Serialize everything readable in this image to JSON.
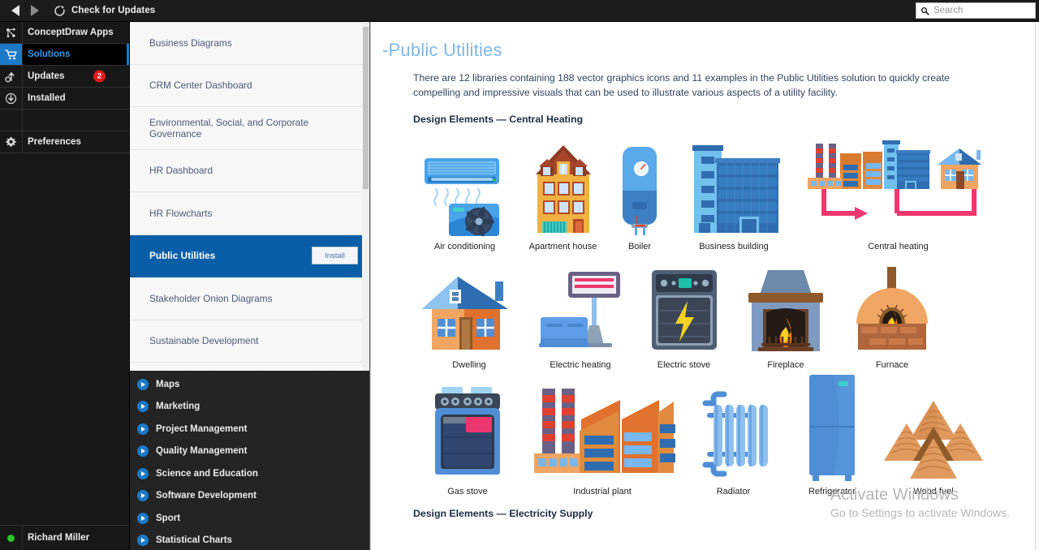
{
  "topbar": {
    "back_icon": "triangle-left-icon",
    "forward_icon": "triangle-right-icon",
    "refresh_icon": "refresh-icon",
    "check_updates_label": "Check for Updates",
    "search_icon": "search-icon",
    "search_placeholder": "Search",
    "search_value": ""
  },
  "sidebar": {
    "items": [
      {
        "label": "ConceptDraw Apps",
        "icon": "apps-network-icon",
        "selected": false,
        "badge": ""
      },
      {
        "label": "Solutions",
        "icon": "shopping-cart-icon",
        "selected": true,
        "badge": ""
      },
      {
        "label": "Updates",
        "icon": "update-arrow-icon",
        "selected": false,
        "badge": "2"
      },
      {
        "label": "Installed",
        "icon": "download-circle-icon",
        "selected": false,
        "badge": ""
      },
      {
        "label": "",
        "icon": "",
        "selected": false,
        "badge": ""
      },
      {
        "label": "Preferences",
        "icon": "gear-icon",
        "selected": false,
        "badge": ""
      }
    ],
    "user": {
      "name": "Richard Miller",
      "status_icon": "online-status-dot",
      "status_color": "#2fc42f"
    }
  },
  "solutions": {
    "items": [
      {
        "name": "Business Diagrams",
        "selected": false,
        "action": ""
      },
      {
        "name": "CRM Center Dashboard",
        "selected": false,
        "action": ""
      },
      {
        "name": "Environmental, Social, and Corporate Governance",
        "selected": false,
        "action": ""
      },
      {
        "name": "HR Dashboard",
        "selected": false,
        "action": ""
      },
      {
        "name": "HR Flowcharts",
        "selected": false,
        "action": ""
      },
      {
        "name": "Public Utilities",
        "selected": true,
        "action": "Install"
      },
      {
        "name": "Stakeholder Onion Diagrams",
        "selected": false,
        "action": ""
      },
      {
        "name": "Sustainable Development",
        "selected": false,
        "action": ""
      }
    ]
  },
  "categories": {
    "items": [
      {
        "label": "Maps"
      },
      {
        "label": "Marketing"
      },
      {
        "label": "Project Management"
      },
      {
        "label": "Quality Management"
      },
      {
        "label": "Science and Education"
      },
      {
        "label": "Software Development"
      },
      {
        "label": "Sport"
      },
      {
        "label": "Statistical Charts"
      }
    ]
  },
  "main": {
    "title_prefix": "-",
    "title": "Public Utilities",
    "description": "There are 12 libraries containing 188 vector graphics icons and 11 examples in the Public Utilities solution to quickly create compelling and impressive visuals that can be used to illustrate various aspects of a utility facility.",
    "section1_heading": "Design Elements — Central Heating",
    "section2_heading": "Design Elements — Electricity Supply",
    "rows": [
      [
        {
          "caption": "Air conditioning",
          "icon": "air-conditioning-icon"
        },
        {
          "caption": "Apartment house",
          "icon": "apartment-house-icon"
        },
        {
          "caption": "Boiler",
          "icon": "boiler-icon"
        },
        {
          "caption": "Business building",
          "icon": "business-building-icon"
        },
        {
          "caption": "Central heating",
          "icon": "central-heating-icon"
        }
      ],
      [
        {
          "caption": "Dwelling",
          "icon": "dwelling-icon"
        },
        {
          "caption": "Electric heating",
          "icon": "electric-heating-icon"
        },
        {
          "caption": "Electric stove",
          "icon": "electric-stove-icon"
        },
        {
          "caption": "Fireplace",
          "icon": "fireplace-icon"
        },
        {
          "caption": "Furnace",
          "icon": "furnace-icon"
        }
      ],
      [
        {
          "caption": "Gas stove",
          "icon": "gas-stove-icon"
        },
        {
          "caption": "Industrial plant",
          "icon": "industrial-plant-icon"
        },
        {
          "caption": "Radiator",
          "icon": "radiator-icon"
        },
        {
          "caption": "Refrigerator",
          "icon": "refrigerator-icon"
        },
        {
          "caption": "Wood fuel",
          "icon": "wood-fuel-icon"
        }
      ]
    ]
  },
  "watermark": {
    "line1": "Activate Windows",
    "line2": "Go to Settings to activate Windows."
  },
  "colors": {
    "accent": "#1b79c8",
    "selected_row": "#0a5ea8",
    "badge": "#e01b1b",
    "title": "#7db7e8",
    "online": "#2fc42f"
  }
}
